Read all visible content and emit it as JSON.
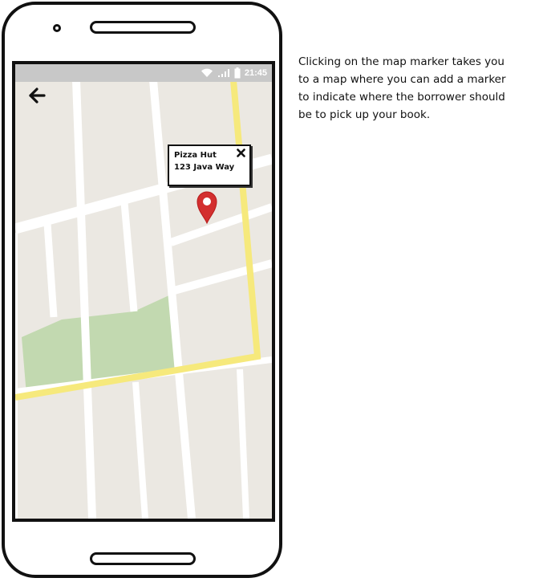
{
  "status_bar": {
    "time": "21:45",
    "wifi_icon": "wifi-icon",
    "signal_icon": "signal-icon",
    "battery_icon": "battery-icon"
  },
  "toolbar": {
    "back_icon": "arrow-left-icon"
  },
  "map": {
    "popup": {
      "name": "Pizza Hut",
      "address": "123 Java Way",
      "close_icon": "close-icon"
    },
    "marker_icon": "map-marker-icon",
    "colors": {
      "land": "#ebe8e2",
      "road": "#ffffff",
      "highway": "#f6e97c",
      "park": "#c2d9b0",
      "marker": "#d32f2f"
    }
  },
  "annotation": {
    "text": "Clicking on the map marker takes you\nto a map where you can add a marker\nto indicate where the borrower should\nbe to pick up your book."
  }
}
